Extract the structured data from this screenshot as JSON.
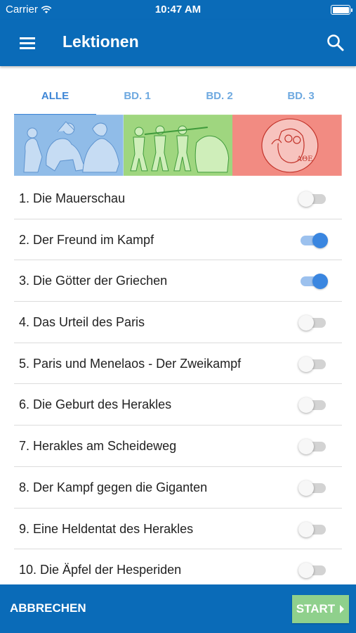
{
  "status_bar": {
    "carrier": "Carrier",
    "time": "10:47 AM"
  },
  "app_bar": {
    "title": "Lektionen"
  },
  "tabs": [
    {
      "label": "ALLE",
      "active": true
    },
    {
      "label": "BD. 1",
      "active": false
    },
    {
      "label": "BD. 2",
      "active": false
    },
    {
      "label": "BD. 3",
      "active": false
    }
  ],
  "banner": {
    "colors": [
      "#90bce8",
      "#9fd67f",
      "#f28b82"
    ]
  },
  "lessons": [
    {
      "label": "1. Die Mauerschau",
      "enabled": false
    },
    {
      "label": "2. Der Freund im Kampf",
      "enabled": true
    },
    {
      "label": "3. Die Götter der Griechen",
      "enabled": true
    },
    {
      "label": "4. Das Urteil des Paris",
      "enabled": false
    },
    {
      "label": "5. Paris und Menelaos - Der Zweikampf",
      "enabled": false
    },
    {
      "label": "6. Die Geburt des Herakles",
      "enabled": false
    },
    {
      "label": "7. Herakles am Scheideweg",
      "enabled": false
    },
    {
      "label": "8. Der Kampf gegen die Giganten",
      "enabled": false
    },
    {
      "label": "9. Eine Heldentat des Herakles",
      "enabled": false
    },
    {
      "label": "10. Die Äpfel der Hesperiden",
      "enabled": false
    }
  ],
  "bottom_bar": {
    "cancel_label": "ABBRECHEN",
    "start_label": "START"
  },
  "colors": {
    "primary": "#0a6bb8",
    "accent": "#3a86e0",
    "start_button": "#8fd08c"
  }
}
